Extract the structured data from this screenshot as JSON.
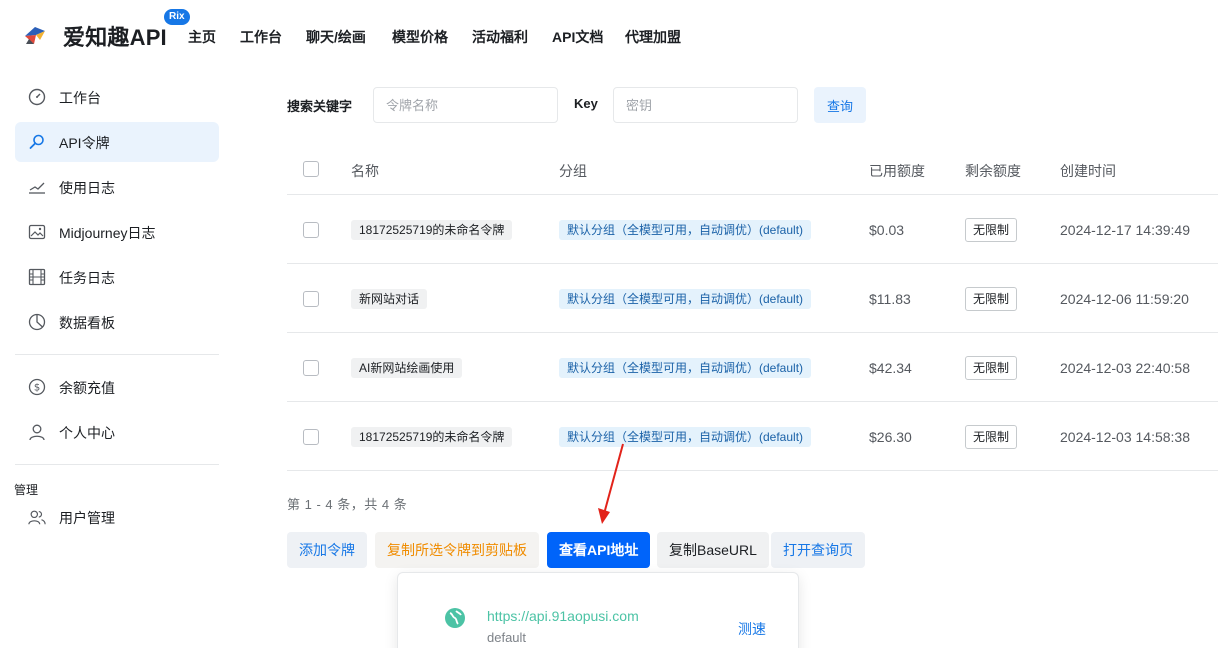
{
  "header": {
    "brand": "爱知趣API",
    "badge": "Rix",
    "nav": [
      "主页",
      "工作台",
      "聊天/绘画",
      "模型价格",
      "活动福利",
      "API文档",
      "代理加盟"
    ]
  },
  "sidebar": {
    "items": [
      {
        "label": "工作台",
        "icon": "dashboard-icon"
      },
      {
        "label": "API令牌",
        "icon": "search-key-icon",
        "active": true
      },
      {
        "label": "使用日志",
        "icon": "chart-icon"
      },
      {
        "label": "Midjourney日志",
        "icon": "image-icon"
      },
      {
        "label": "任务日志",
        "icon": "film-icon"
      },
      {
        "label": "数据看板",
        "icon": "pie-icon"
      },
      {
        "label": "余额充值",
        "icon": "coin-icon"
      },
      {
        "label": "个人中心",
        "icon": "user-icon"
      },
      {
        "label": "用户管理",
        "icon": "users-icon"
      }
    ],
    "section_admin": "管理"
  },
  "search": {
    "label": "搜索关键字",
    "name_placeholder": "令牌名称",
    "key_label": "Key",
    "key_placeholder": "密钥",
    "query_button": "查询"
  },
  "table": {
    "headers": {
      "name": "名称",
      "group": "分组",
      "used": "已用额度",
      "remaining": "剩余额度",
      "created": "创建时间"
    },
    "rows": [
      {
        "name": "18172525719的未命名令牌",
        "group": "默认分组（全模型可用，自动调优）(default)",
        "used": "$0.03",
        "remaining": "无限制",
        "created": "2024-12-17 14:39:49"
      },
      {
        "name": "新网站对话",
        "group": "默认分组（全模型可用，自动调优）(default)",
        "used": "$11.83",
        "remaining": "无限制",
        "created": "2024-12-06 11:59:20"
      },
      {
        "name": "AI新网站绘画使用",
        "group": "默认分组（全模型可用，自动调优）(default)",
        "used": "$42.34",
        "remaining": "无限制",
        "created": "2024-12-03 22:40:58"
      },
      {
        "name": "18172525719的未命名令牌",
        "group": "默认分组（全模型可用，自动调优）(default)",
        "used": "$26.30",
        "remaining": "无限制",
        "created": "2024-12-03 14:58:38"
      }
    ]
  },
  "pager": "第 1 - 4 条，共 4 条",
  "actions": {
    "add": "添加令牌",
    "copy_selected": "复制所选令牌到剪贴板",
    "view_api": "查看API地址",
    "copy_base": "复制BaseURL",
    "open_query": "打开查询页"
  },
  "popup": {
    "url": "https://api.91aopusi.com",
    "sub": "default",
    "test": "测速"
  },
  "colors": {
    "accent": "#0064fa",
    "active_bg": "#eaf3fd",
    "tag_group_bg": "#e4f2fc",
    "url_green": "#4cc3a5"
  }
}
